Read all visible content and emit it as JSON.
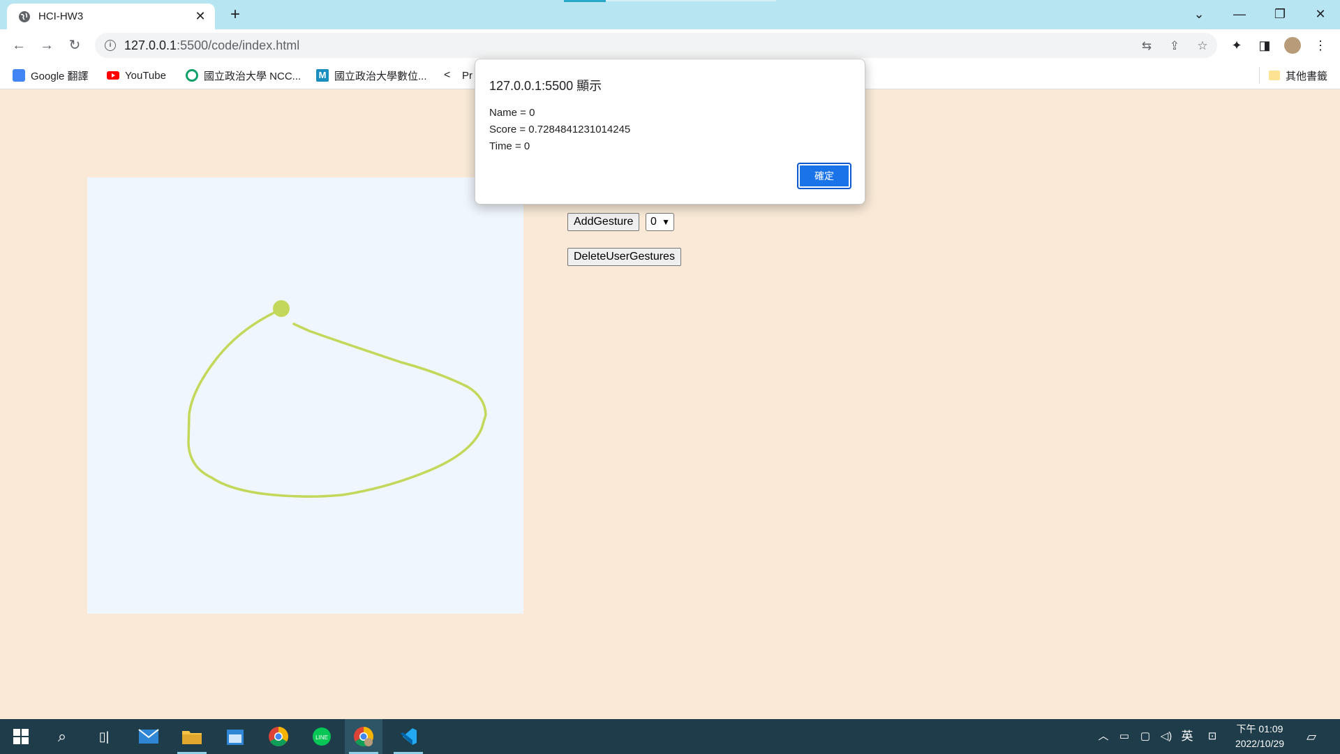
{
  "browser": {
    "tab_title": "HCI-HW3",
    "url_host": "127.0.0.1",
    "url_path": ":5500/code/index.html",
    "bookmarks": [
      {
        "label": "Google 翻譯",
        "icon": "google-translate-icon",
        "color": "#4285f4"
      },
      {
        "label": "YouTube",
        "icon": "youtube-icon",
        "color": "#ff0000"
      },
      {
        "label": "國立政治大學 NCC...",
        "icon": "nccu-icon",
        "color": "#12a06a"
      },
      {
        "label": "國立政治大學數位...",
        "icon": "moodle-icon",
        "color": "#1a8fbf"
      },
      {
        "label": "Pr",
        "icon": "prairielearn-icon",
        "color": "#202124"
      }
    ],
    "other_bookmarks": "其他書籤"
  },
  "page": {
    "add_gesture_label": "AddGesture",
    "gesture_select_value": "0",
    "delete_label": "DeleteUserGestures",
    "stroke_color": "#c3d85a",
    "canvas_color": "#eff6fd"
  },
  "dialog": {
    "title": "127.0.0.1:5500 顯示",
    "lines": [
      "Name = 0",
      "Score = 0.7284841231014245",
      "Time = 0"
    ],
    "ok_label": "確定"
  },
  "taskbar": {
    "ime": "英",
    "time": "下午 01:09",
    "date": "2022/10/29"
  }
}
